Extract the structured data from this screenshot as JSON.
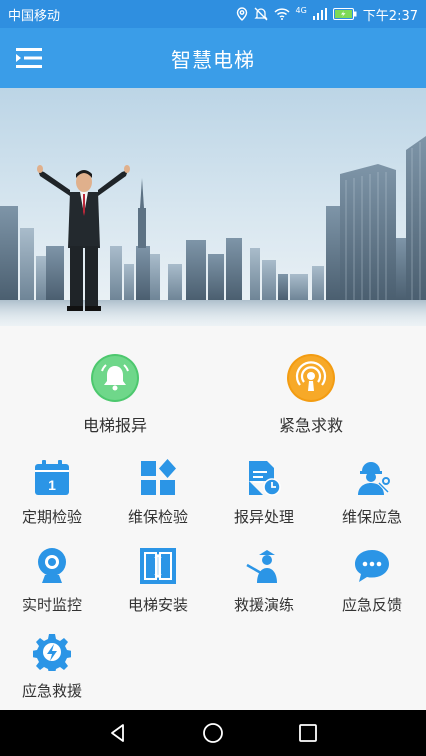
{
  "status_bar": {
    "carrier": "中国移动",
    "signal_label": "4G",
    "time": "下午2:37"
  },
  "app_bar": {
    "title": "智慧电梯",
    "menu_icon": "menu-icon"
  },
  "colors": {
    "primary": "#3a9de8",
    "status_bar": "#2f8fe0",
    "grid_icon": "#2b95e6",
    "report_icon": "#4dc86e",
    "sos_icon": "#f39c12"
  },
  "primary_actions": [
    {
      "label": "电梯报异",
      "icon": "bell-icon"
    },
    {
      "label": "紧急求救",
      "icon": "sos-broadcast-icon"
    }
  ],
  "grid": [
    {
      "label": "定期检验",
      "icon": "calendar-icon"
    },
    {
      "label": "维保检验",
      "icon": "blocks-icon"
    },
    {
      "label": "报异处理",
      "icon": "document-clock-icon"
    },
    {
      "label": "维保应急",
      "icon": "worker-icon"
    },
    {
      "label": "实时监控",
      "icon": "webcam-icon"
    },
    {
      "label": "电梯安装",
      "icon": "elevator-door-icon"
    },
    {
      "label": "救援演练",
      "icon": "instructor-icon"
    },
    {
      "label": "应急反馈",
      "icon": "chat-bubble-icon"
    },
    {
      "label": "应急救援",
      "icon": "gear-lightning-icon"
    }
  ]
}
